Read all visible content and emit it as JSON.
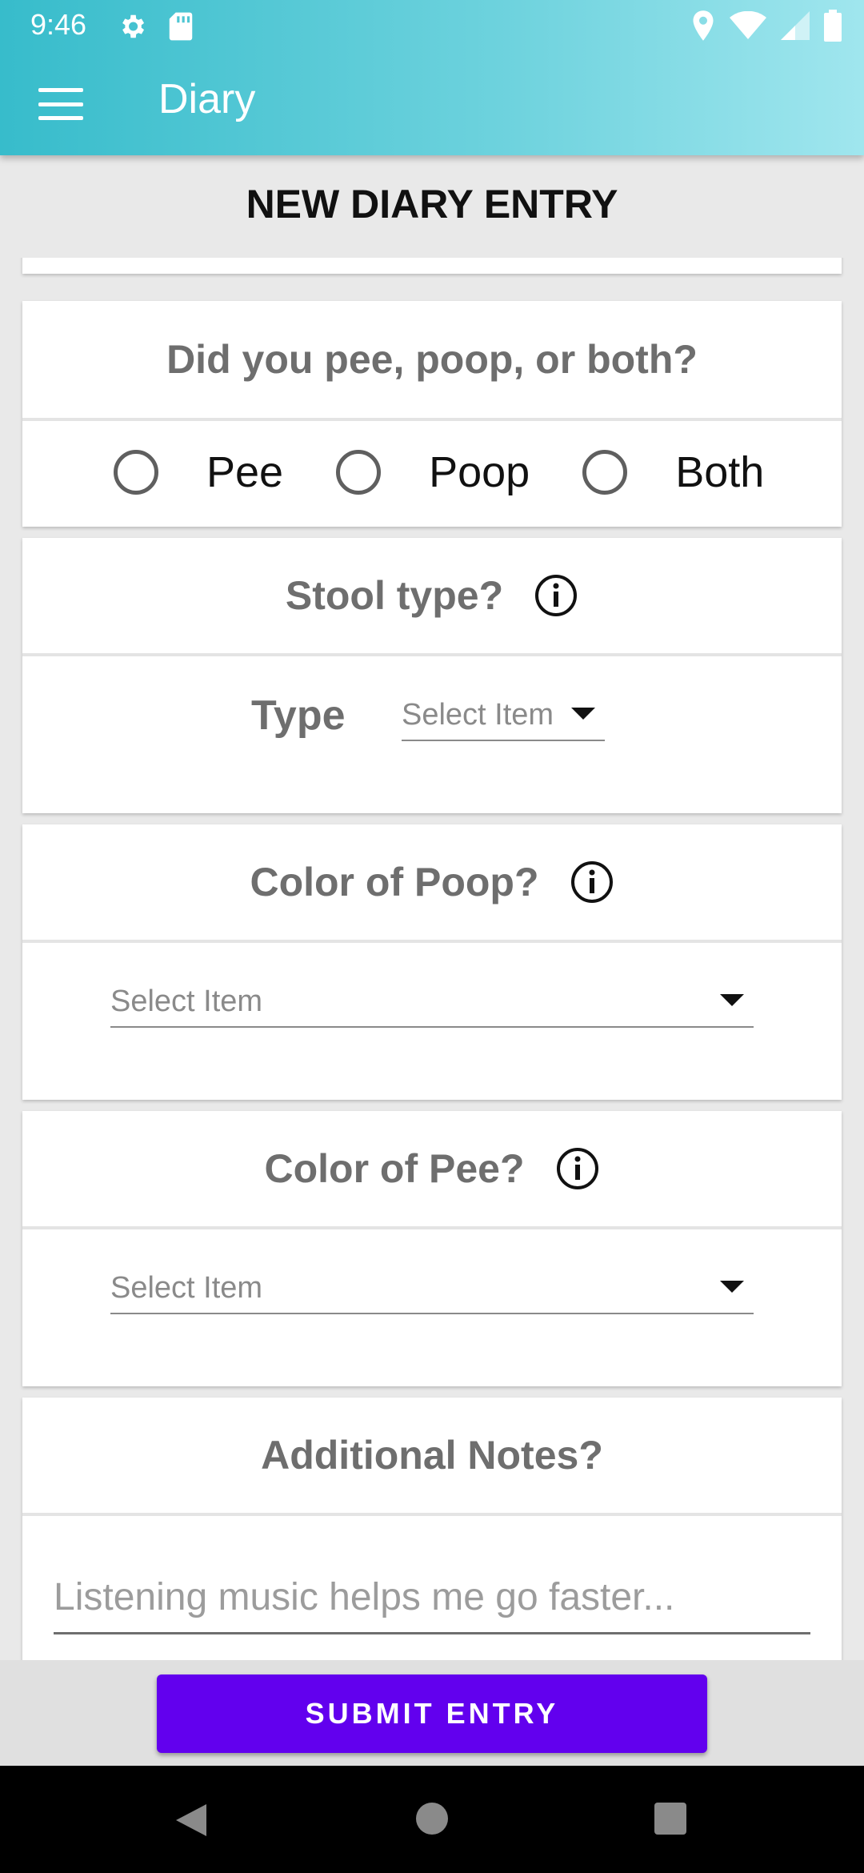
{
  "status_bar": {
    "time": "9:46",
    "left_icons": [
      "gear-icon",
      "sd-card-icon"
    ],
    "right_icons": [
      "location-icon",
      "wifi-icon",
      "signal-icon",
      "battery-icon"
    ]
  },
  "app_bar": {
    "title": "Diary",
    "menu_icon": "hamburger-menu-icon",
    "gradient_start": "#37bccb",
    "gradient_end": "#a0e6ee"
  },
  "page": {
    "heading": "NEW DIARY ENTRY"
  },
  "sections": {
    "excretion": {
      "question": "Did you pee, poop, or both?",
      "options": [
        "Pee",
        "Poop",
        "Both"
      ]
    },
    "stool_type": {
      "question": "Stool type?",
      "field_label": "Type",
      "select_value": "Select Item"
    },
    "poop_color": {
      "question": "Color of Poop?",
      "select_value": "Select Item"
    },
    "pee_color": {
      "question": "Color of Pee?",
      "select_value": "Select Item"
    },
    "notes": {
      "question": "Additional Notes?",
      "placeholder": "Listening music helps me go faster..."
    }
  },
  "submit": {
    "label": "SUBMIT ENTRY",
    "color": "#6200ee"
  },
  "nav_bar": {
    "icons": [
      "back-icon",
      "home-icon",
      "recents-icon"
    ]
  }
}
